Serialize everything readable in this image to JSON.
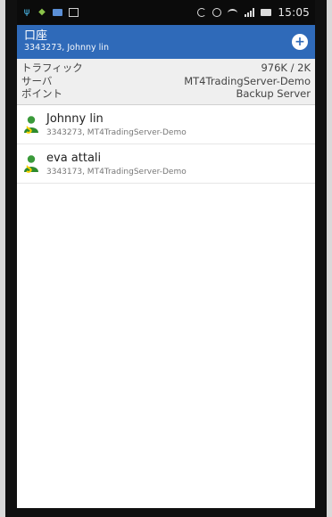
{
  "status_bar": {
    "time": "15:05",
    "icons": [
      "usb-icon",
      "android-icon",
      "message-icon",
      "image-icon",
      "sync-icon",
      "alarm-icon",
      "wifi-icon",
      "signal-icon",
      "battery-icon"
    ]
  },
  "app_bar": {
    "title": "口座",
    "subtitle": "3343273, Johnny lin",
    "add_icon": "plus-circle-icon",
    "color": "#2f6ab9"
  },
  "info": {
    "rows": [
      {
        "label": "トラフィック",
        "value": "976K / 2K"
      },
      {
        "label": "サーバ",
        "value": "MT4TradingServer-Demo"
      },
      {
        "label": "ポイント",
        "value": "Backup Server"
      }
    ]
  },
  "accounts": [
    {
      "name": "Johnny lin",
      "detail": "3343273, MT4TradingServer-Demo",
      "icon": "user-account-icon"
    },
    {
      "name": "eva attali",
      "detail": "3343173, MT4TradingServer-Demo",
      "icon": "user-account-icon"
    }
  ]
}
